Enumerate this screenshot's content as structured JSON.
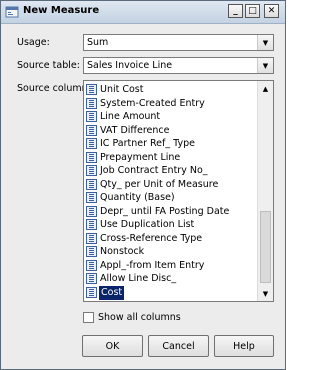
{
  "window": {
    "title": "New Measure"
  },
  "titlebar_buttons": [
    "minimize-icon",
    "maximize-icon",
    "close-icon"
  ],
  "usage": {
    "label": "Usage:",
    "value": "Sum"
  },
  "source_table": {
    "label": "Source table:",
    "value": "Sales Invoice Line"
  },
  "source_column": {
    "label": "Source column:",
    "items": [
      "Unit Cost",
      "System-Created Entry",
      "Line Amount",
      "VAT Difference",
      "IC Partner Ref_ Type",
      "Prepayment Line",
      "Job Contract Entry No_",
      "Qty_ per Unit of Measure",
      "Quantity (Base)",
      "Depr_ until FA Posting Date",
      "Use Duplication List",
      "Cross-Reference Type",
      "Nonstock",
      "Appl_-from Item Entry",
      "Allow Line Disc_",
      "Cost"
    ],
    "selected": "Cost"
  },
  "show_all_columns": {
    "label": "Show all columns",
    "checked": false
  },
  "buttons": {
    "ok": "OK",
    "cancel": "Cancel",
    "help": "Help"
  },
  "colors": {
    "selection": "#0a246a",
    "dialog_bg": "#ececec"
  }
}
